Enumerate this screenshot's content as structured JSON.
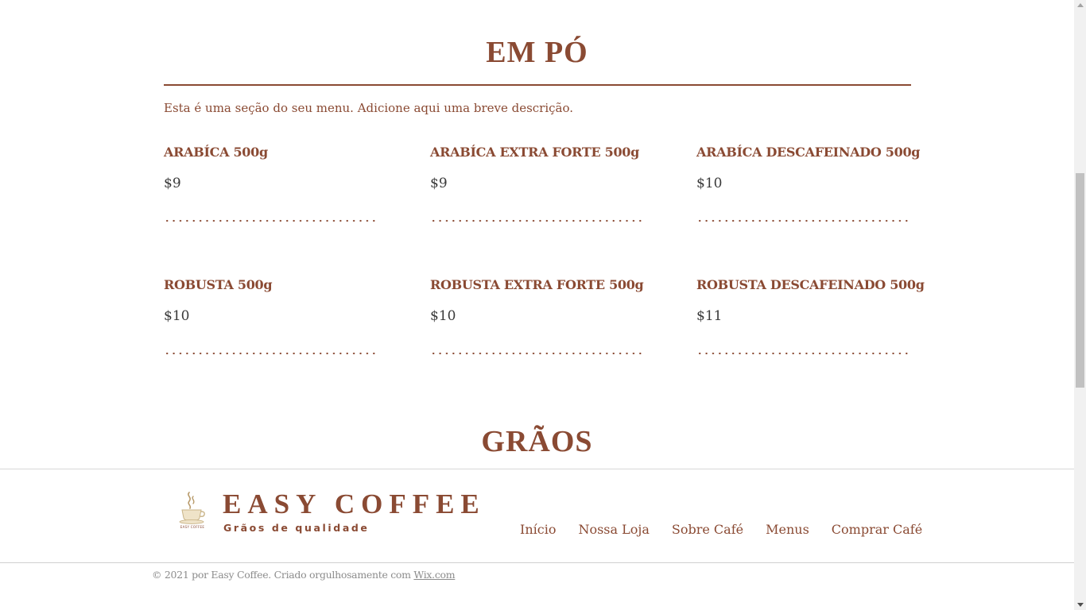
{
  "sections": [
    {
      "title": "EM PÓ",
      "description": "Esta é uma seção do seu menu. Adicione aqui uma breve descrição.",
      "items": [
        {
          "name": "ARABÍCA 500g",
          "price": "$9"
        },
        {
          "name": "ARABÍCA EXTRA FORTE 500g",
          "price": "$9"
        },
        {
          "name": "ARABÍCA DESCAFEINADO 500g",
          "price": "$10"
        },
        {
          "name": "ROBUSTA 500g",
          "price": "$10"
        },
        {
          "name": "ROBUSTA EXTRA FORTE 500g",
          "price": "$10"
        },
        {
          "name": "ROBUSTA DESCAFEINADO 500g",
          "price": "$11"
        }
      ]
    },
    {
      "title": "GRÃOS"
    }
  ],
  "footer": {
    "logo_icon": "coffee-cup-icon",
    "logo_small_text": "EASY COFFEE",
    "brand_name": "EASY COFFEE",
    "tagline": "Grãos de qualidade",
    "nav": [
      "Início",
      "Nossa Loja",
      "Sobre Café",
      "Menus",
      "Comprar Café"
    ]
  },
  "copyright": {
    "text": "© 2021 por Easy Coffee. Criado orgulhosamente com ",
    "link": "Wix.com"
  },
  "colors": {
    "brand": "#8a4a33",
    "price_text": "#3a3a3a",
    "muted": "#8c8c8c"
  }
}
